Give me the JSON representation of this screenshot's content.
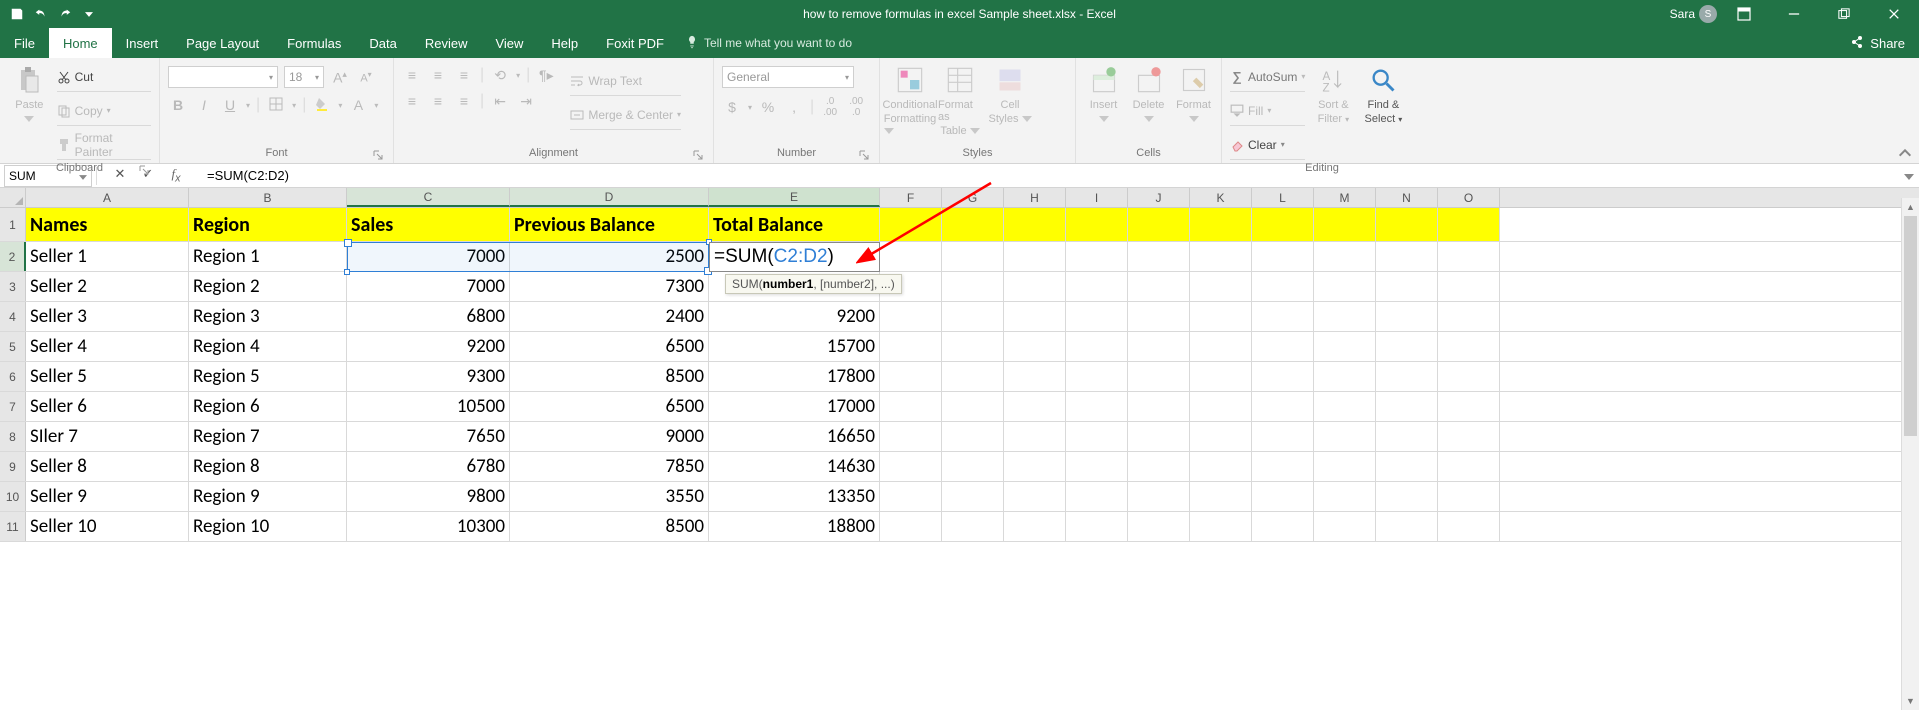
{
  "title": {
    "filename": "how to remove formulas in excel Sample sheet.xlsx",
    "app": "Excel",
    "combined": "how to remove formulas in excel Sample sheet.xlsx  -  Excel"
  },
  "user": {
    "name": "Sara",
    "initial": "S"
  },
  "tabs": {
    "file": "File",
    "home": "Home",
    "insert": "Insert",
    "pagelayout": "Page Layout",
    "formulas": "Formulas",
    "data": "Data",
    "review": "Review",
    "view": "View",
    "help": "Help",
    "foxit": "Foxit PDF",
    "tellme": "Tell me what you want to do",
    "share": "Share"
  },
  "ribbon": {
    "clipboard": {
      "label": "Clipboard",
      "paste": "Paste",
      "cut": "Cut",
      "copy": "Copy",
      "painter": "Format Painter"
    },
    "font": {
      "label": "Font",
      "size": "18",
      "bold": "B",
      "italic": "I",
      "underline": "U"
    },
    "alignment": {
      "label": "Alignment",
      "wrap": "Wrap Text",
      "merge": "Merge & Center"
    },
    "number": {
      "label": "Number",
      "format": "General",
      "currency": "$",
      "percent": "%",
      "comma": ","
    },
    "styles": {
      "label": "Styles",
      "cond": "Conditional Formatting",
      "cond1": "Conditional",
      "cond2": "Formatting",
      "table": "Format as Table",
      "table1": "Format as",
      "table2": "Table",
      "cell": "Cell Styles",
      "cell1": "Cell",
      "cell2": "Styles"
    },
    "cells": {
      "label": "Cells",
      "insert": "Insert",
      "delete": "Delete",
      "format": "Format"
    },
    "editing": {
      "label": "Editing",
      "autosum": "AutoSum",
      "fill": "Fill",
      "clear": "Clear",
      "sort": "Sort & Filter",
      "sort1": "Sort &",
      "sort2": "Filter",
      "find": "Find & Select",
      "find1": "Find &",
      "find2": "Select"
    }
  },
  "namebox": "SUM",
  "formulabar": "=SUM(C2:D2)",
  "active_formula": {
    "eq": "=",
    "fn": "SUM(",
    "range": "C2:D2",
    "close": ")"
  },
  "tooltip": {
    "fn": "SUM(",
    "arg1": "number1",
    "rest": ", [number2], ...)"
  },
  "columns": [
    "A",
    "B",
    "C",
    "D",
    "E",
    "F",
    "G",
    "H",
    "I",
    "J",
    "K",
    "L",
    "M",
    "N",
    "O"
  ],
  "headers": {
    "A": "Names",
    "B": "Region",
    "C": "Sales",
    "D": "Previous Balance",
    "E": "Total Balance"
  },
  "rows": [
    {
      "n": "2",
      "A": "Seller 1",
      "B": "Region 1",
      "C": "7000",
      "D": "2500",
      "E": ""
    },
    {
      "n": "3",
      "A": "Seller 2",
      "B": "Region 2",
      "C": "7000",
      "D": "7300",
      "E": ""
    },
    {
      "n": "4",
      "A": "Seller 3",
      "B": "Region 3",
      "C": "6800",
      "D": "2400",
      "E": "9200"
    },
    {
      "n": "5",
      "A": "Seller 4",
      "B": "Region 4",
      "C": "9200",
      "D": "6500",
      "E": "15700"
    },
    {
      "n": "6",
      "A": "Seller 5",
      "B": "Region 5",
      "C": "9300",
      "D": "8500",
      "E": "17800"
    },
    {
      "n": "7",
      "A": "Seller 6",
      "B": "Region 6",
      "C": "10500",
      "D": "6500",
      "E": "17000"
    },
    {
      "n": "8",
      "A": "SIler 7",
      "B": "Region 7",
      "C": "7650",
      "D": "9000",
      "E": "16650"
    },
    {
      "n": "9",
      "A": "Seller 8",
      "B": "Region 8",
      "C": "6780",
      "D": "7850",
      "E": "14630"
    },
    {
      "n": "10",
      "A": "Seller 9",
      "B": "Region 9",
      "C": "9800",
      "D": "3550",
      "E": "13350"
    },
    {
      "n": "11",
      "A": "Seller 10",
      "B": "Region 10",
      "C": "10300",
      "D": "8500",
      "E": "18800"
    }
  ]
}
